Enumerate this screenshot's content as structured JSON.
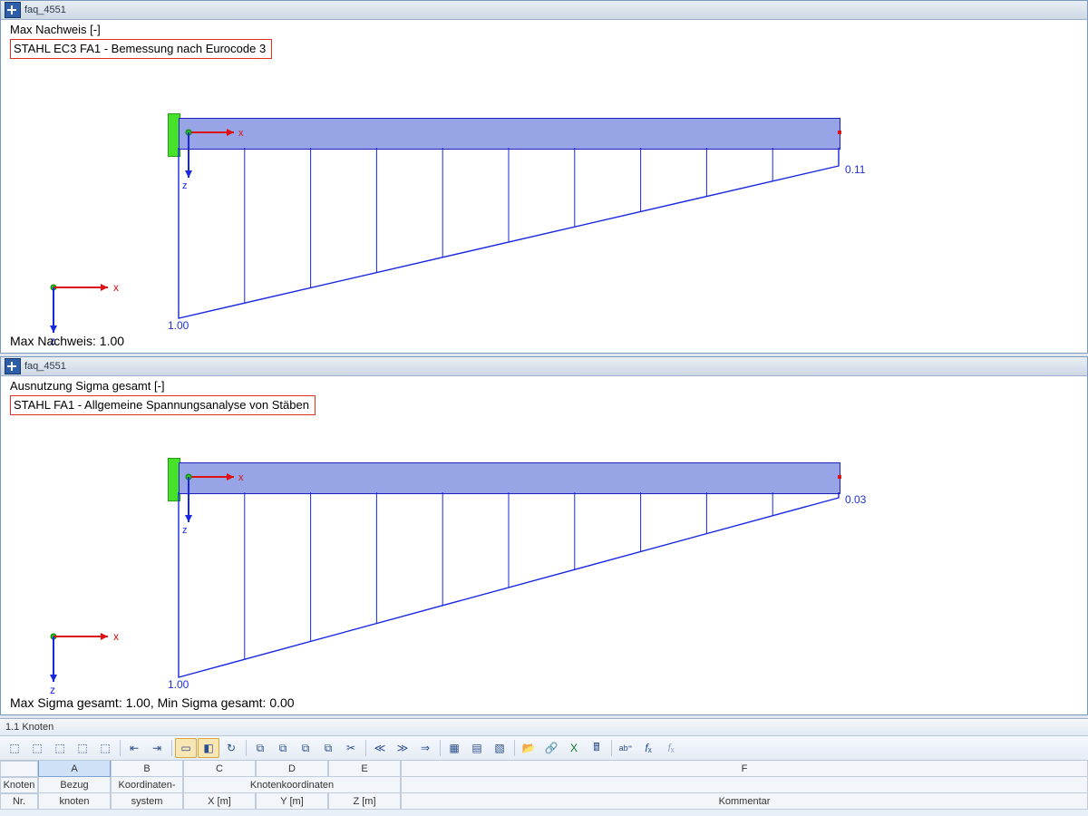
{
  "panes": [
    {
      "title": "faq_4551",
      "header1": "Max Nachweis [-]",
      "header2": "STAHL EC3 FA1 - Bemessung nach Eurocode 3",
      "right_value": "0.11",
      "left_value": "1.00",
      "footer": "Max Nachweis: 1.00"
    },
    {
      "title": "faq_4551",
      "header1": "Ausnutzung Sigma gesamt [-]",
      "header2": "STAHL FA1 - Allgemeine Spannungsanalyse von Stäben",
      "right_value": "0.03",
      "left_value": "1.00",
      "footer": "Max Sigma gesamt: 1.00, Min Sigma gesamt: 0.00"
    }
  ],
  "axis": {
    "x": "x",
    "z": "z"
  },
  "grid": {
    "tab": "1.1 Knoten",
    "letters": [
      "A",
      "B",
      "C",
      "D",
      "E",
      "F"
    ],
    "row1": {
      "nr": "Knoten",
      "a": "Bezug",
      "b": "Koordinaten-",
      "cde": "Knotenkoordinaten",
      "f": ""
    },
    "row2": {
      "nr": "Nr.",
      "a": "knoten",
      "b": "system",
      "c": "X [m]",
      "d": "Y [m]",
      "e": "Z [m]",
      "f": "Kommentar"
    }
  },
  "chart_data": [
    {
      "type": "area",
      "title": "Max Nachweis STAHL EC3",
      "xlabel": "x",
      "ylabel": "z",
      "x_range": [
        0,
        1
      ],
      "series": [
        {
          "name": "Nachweis",
          "values_at_endpoints": {
            "x0": 1.0,
            "x1": 0.11
          }
        }
      ]
    },
    {
      "type": "area",
      "title": "Ausnutzung Sigma gesamt",
      "xlabel": "x",
      "ylabel": "z",
      "x_range": [
        0,
        1
      ],
      "series": [
        {
          "name": "Sigma",
          "values_at_endpoints": {
            "x0": 1.0,
            "x1": 0.03
          }
        }
      ]
    }
  ]
}
